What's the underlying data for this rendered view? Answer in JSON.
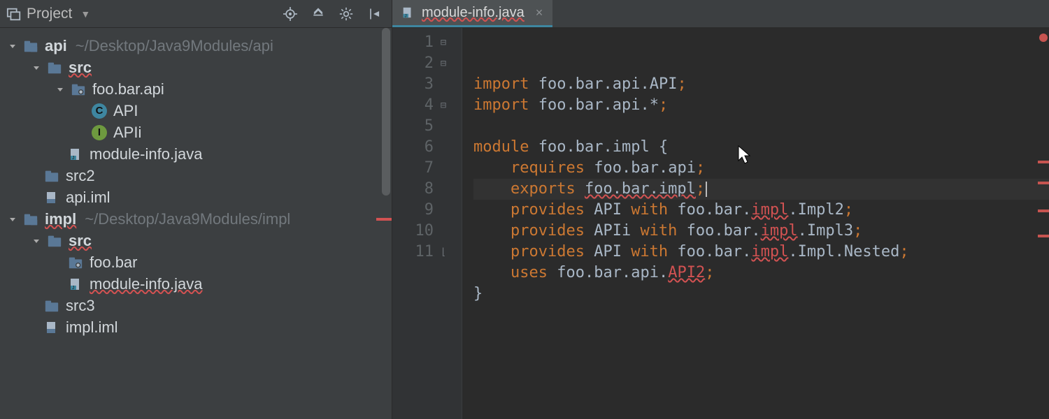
{
  "project_pane": {
    "title": "Project",
    "toolbar": {
      "target_icon": "target-icon",
      "collapse_icon": "collapse-all-icon",
      "settings_icon": "gear-icon",
      "hide_icon": "hide-panel-icon"
    },
    "tree": [
      {
        "depth": 0,
        "arrow": "down",
        "icon": "module",
        "label": "api",
        "bold": true,
        "path": "~/Desktop/Java9Modules/api"
      },
      {
        "depth": 1,
        "arrow": "down",
        "icon": "folder",
        "label": "src",
        "wavy": true,
        "bold": true
      },
      {
        "depth": 2,
        "arrow": "down",
        "icon": "package",
        "label": "foo.bar.api"
      },
      {
        "depth": 3,
        "arrow": "",
        "icon": "class",
        "label": "API"
      },
      {
        "depth": 3,
        "arrow": "",
        "icon": "interface",
        "label": "APIi"
      },
      {
        "depth": 2,
        "arrow": "",
        "icon": "javafile",
        "label": "module-info.java"
      },
      {
        "depth": 1,
        "arrow": "",
        "icon": "folder",
        "label": "src2"
      },
      {
        "depth": 1,
        "arrow": "",
        "icon": "imlfile",
        "label": "api.iml"
      },
      {
        "depth": 0,
        "arrow": "down",
        "icon": "module",
        "label": "impl",
        "bold": true,
        "wavy": true,
        "path": "~/Desktop/Java9Modules/impl"
      },
      {
        "depth": 1,
        "arrow": "down",
        "icon": "folder",
        "label": "src",
        "bold": true,
        "wavy": true
      },
      {
        "depth": 2,
        "arrow": "",
        "icon": "package",
        "label": "foo.bar"
      },
      {
        "depth": 2,
        "arrow": "",
        "icon": "javafile",
        "label": "module-info.java",
        "wavy": true
      },
      {
        "depth": 1,
        "arrow": "",
        "icon": "folder",
        "label": "src3"
      },
      {
        "depth": 1,
        "arrow": "",
        "icon": "imlfile",
        "label": "impl.iml"
      }
    ],
    "error_markers": [
      8
    ]
  },
  "editor": {
    "tab_filename": "module-info.java",
    "tab_wavy": true,
    "line_numbers": [
      "1",
      "2",
      "3",
      "4",
      "5",
      "6",
      "7",
      "8",
      "9",
      "10",
      "11"
    ],
    "current_line_index": 5,
    "fold_marks": {
      "0": "⊟",
      "1": "⊟",
      "3": "⊟",
      "10": "⌊"
    },
    "code_lines": [
      {
        "tokens": [
          {
            "t": "import ",
            "c": "kw"
          },
          {
            "t": "foo",
            "c": "id"
          },
          {
            "t": ".",
            "c": "dot"
          },
          {
            "t": "bar",
            "c": "id"
          },
          {
            "t": ".",
            "c": "dot"
          },
          {
            "t": "api",
            "c": "id"
          },
          {
            "t": ".",
            "c": "dot"
          },
          {
            "t": "API",
            "c": "id"
          },
          {
            "t": ";",
            "c": "semi"
          }
        ]
      },
      {
        "tokens": [
          {
            "t": "import ",
            "c": "kw"
          },
          {
            "t": "foo",
            "c": "id"
          },
          {
            "t": ".",
            "c": "dot"
          },
          {
            "t": "bar",
            "c": "id"
          },
          {
            "t": ".",
            "c": "dot"
          },
          {
            "t": "api",
            "c": "id"
          },
          {
            "t": ".*",
            "c": "id"
          },
          {
            "t": ";",
            "c": "semi"
          }
        ]
      },
      {
        "tokens": [
          {
            "t": "",
            "c": "id"
          }
        ]
      },
      {
        "tokens": [
          {
            "t": "module ",
            "c": "kw"
          },
          {
            "t": "foo",
            "c": "id"
          },
          {
            "t": ".",
            "c": "dot"
          },
          {
            "t": "bar",
            "c": "id"
          },
          {
            "t": ".",
            "c": "dot"
          },
          {
            "t": "impl ",
            "c": "id"
          },
          {
            "t": "{",
            "c": "id"
          }
        ]
      },
      {
        "tokens": [
          {
            "t": "    ",
            "c": "id"
          },
          {
            "t": "requires ",
            "c": "kw"
          },
          {
            "t": "foo",
            "c": "id"
          },
          {
            "t": ".",
            "c": "dot"
          },
          {
            "t": "bar",
            "c": "id"
          },
          {
            "t": ".",
            "c": "dot"
          },
          {
            "t": "api",
            "c": "id"
          },
          {
            "t": ";",
            "c": "semi"
          }
        ]
      },
      {
        "tokens": [
          {
            "t": "    ",
            "c": "id"
          },
          {
            "t": "exports ",
            "c": "kw"
          },
          {
            "t": "foo.bar.impl",
            "c": "id",
            "wavy": true
          },
          {
            "t": ";",
            "c": "semi"
          }
        ],
        "caret": true
      },
      {
        "tokens": [
          {
            "t": "    ",
            "c": "id"
          },
          {
            "t": "provides ",
            "c": "kw"
          },
          {
            "t": "API ",
            "c": "id"
          },
          {
            "t": "with ",
            "c": "kw"
          },
          {
            "t": "foo",
            "c": "id"
          },
          {
            "t": ".",
            "c": "dot"
          },
          {
            "t": "bar",
            "c": "id"
          },
          {
            "t": ".",
            "c": "dot"
          },
          {
            "t": "impl",
            "c": "bad",
            "wavy": true
          },
          {
            "t": ".",
            "c": "dot"
          },
          {
            "t": "Impl2",
            "c": "id"
          },
          {
            "t": ";",
            "c": "semi"
          }
        ]
      },
      {
        "tokens": [
          {
            "t": "    ",
            "c": "id"
          },
          {
            "t": "provides ",
            "c": "kw"
          },
          {
            "t": "APIi ",
            "c": "id"
          },
          {
            "t": "with ",
            "c": "kw"
          },
          {
            "t": "foo",
            "c": "id"
          },
          {
            "t": ".",
            "c": "dot"
          },
          {
            "t": "bar",
            "c": "id"
          },
          {
            "t": ".",
            "c": "dot"
          },
          {
            "t": "impl",
            "c": "bad",
            "wavy": true
          },
          {
            "t": ".",
            "c": "dot"
          },
          {
            "t": "Impl3",
            "c": "id"
          },
          {
            "t": ";",
            "c": "semi"
          }
        ]
      },
      {
        "tokens": [
          {
            "t": "    ",
            "c": "id"
          },
          {
            "t": "provides ",
            "c": "kw"
          },
          {
            "t": "API ",
            "c": "id"
          },
          {
            "t": "with ",
            "c": "kw"
          },
          {
            "t": "foo",
            "c": "id"
          },
          {
            "t": ".",
            "c": "dot"
          },
          {
            "t": "bar",
            "c": "id"
          },
          {
            "t": ".",
            "c": "dot"
          },
          {
            "t": "impl",
            "c": "bad",
            "wavy": true
          },
          {
            "t": ".",
            "c": "dot"
          },
          {
            "t": "Impl",
            "c": "id"
          },
          {
            "t": ".",
            "c": "dot"
          },
          {
            "t": "Nested",
            "c": "id"
          },
          {
            "t": ";",
            "c": "semi"
          }
        ]
      },
      {
        "tokens": [
          {
            "t": "    ",
            "c": "id"
          },
          {
            "t": "uses ",
            "c": "kw"
          },
          {
            "t": "foo",
            "c": "id"
          },
          {
            "t": ".",
            "c": "dot"
          },
          {
            "t": "bar",
            "c": "id"
          },
          {
            "t": ".",
            "c": "dot"
          },
          {
            "t": "api",
            "c": "id"
          },
          {
            "t": ".",
            "c": "dot"
          },
          {
            "t": "API2",
            "c": "bad",
            "wavy": true
          },
          {
            "t": ";",
            "c": "semi"
          }
        ]
      },
      {
        "tokens": [
          {
            "t": "}",
            "c": "id"
          }
        ]
      }
    ],
    "error_strip": {
      "top_dot": true,
      "marks": [
        190,
        220,
        260,
        296
      ]
    }
  }
}
